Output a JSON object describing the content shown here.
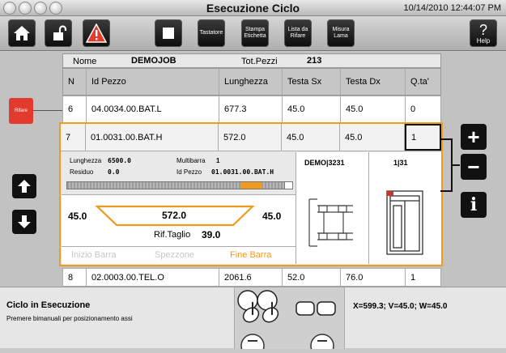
{
  "window": {
    "title": "Esecuzione Ciclo",
    "datetime": "10/14/2010 12:44:07 PM"
  },
  "toolbar": {
    "tastatore": "Tastatore",
    "stampa": "Stampa\nEtichetta",
    "lista": "Lista da\nRifare",
    "misura": "Misura\nLama",
    "help": "Help"
  },
  "side": {
    "rifare_label": "Rifare"
  },
  "job": {
    "nome_label": "Nome",
    "nome_value": "DEMOJOB",
    "totpezzi_label": "Tot.Pezzi",
    "totpezzi_value": "213"
  },
  "table": {
    "headers": [
      "N",
      "Id Pezzo",
      "Lunghezza",
      "Testa Sx",
      "Testa Dx",
      "Q.ta'"
    ],
    "rows": [
      [
        "6",
        "04.0034.00.BAT.L",
        "677.3",
        "45.0",
        "45.0",
        "0"
      ],
      [
        "7",
        "01.0031.00.BAT.H",
        "572.0",
        "45.0",
        "45.0",
        "1"
      ],
      [
        "8",
        "02.0003.00.TEL.O",
        "2061.6",
        "52.0",
        "76.0",
        "1"
      ]
    ]
  },
  "detail": {
    "lunghezza_label": "Lunghezza",
    "lunghezza_value": "6500.0",
    "multibarra_label": "Multibarra",
    "multibarra_value": "1",
    "residuo_label": "Residuo",
    "residuo_value": "0.0",
    "idpezzo_label": "Id Pezzo",
    "idpezzo_value": "01.0031.00.BAT.H",
    "angle_left": "45.0",
    "length": "572.0",
    "angle_right": "45.0",
    "riftaglio_label": "Rif.Taglio",
    "riftaglio_value": "39.0",
    "progress": 0.9,
    "inizio": "Inizio Barra",
    "spezzone": "Spezzone",
    "fine": "Fine Barra",
    "demo_label": "DEMO|3231",
    "fraction_label": "1|31"
  },
  "status": {
    "title": "Ciclo in Esecuzione",
    "message": "Premere bimanuali per posizionamento assi",
    "coords": "X=599.3; V=45.0; W=45.0"
  },
  "colors": {
    "accent": "#f29a1f",
    "red": "#e23b2e",
    "dark": "#111111"
  }
}
